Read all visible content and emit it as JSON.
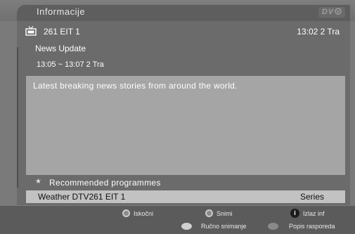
{
  "header": {
    "title": "Informacije",
    "logo_text": "DV"
  },
  "channel": {
    "icon": "tv-antenna-icon",
    "name": "261 EIT 1",
    "clock": "13:02 2 Tra"
  },
  "programme": {
    "title": "News Update",
    "time_range": "13:05 ~ 13:07 2 Tra",
    "description": "Latest breaking news stories from around the world."
  },
  "recommended": {
    "label": "Recommended programmes",
    "icon": "star-icon"
  },
  "selected_programme": {
    "name": "Weather DTV261 EIT 1",
    "type": "Series"
  },
  "help_bar": {
    "row1": [
      {
        "icon": "ring-button-icon",
        "label": "Iskočni"
      },
      {
        "icon": "ring-button-icon",
        "label": "Snimi"
      },
      {
        "icon": "info-button-icon",
        "label": "Izlaz inf",
        "glyph": "i"
      }
    ],
    "row2": [
      {
        "icon": "light-button-icon",
        "label": "Ručno snimanje"
      },
      {
        "icon": "dark-button-icon",
        "label": "Popis rasporeda"
      }
    ]
  }
}
